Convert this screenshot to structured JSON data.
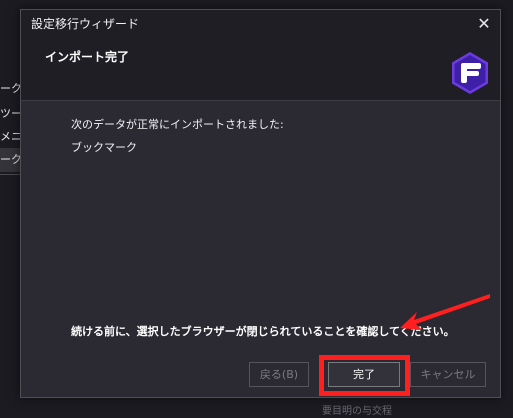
{
  "background": {
    "sidebar_items": [
      "ーク",
      "ツール",
      "メニュ",
      "ーク"
    ],
    "bottom_text": "要目明の与交程"
  },
  "dialog": {
    "title": "設定移行ウィザード",
    "heading": "インポート完了",
    "message": "次のデータが正常にインポートされました:",
    "items": [
      "ブックマーク"
    ],
    "note": "続ける前に、選択したブラウザーが閉じられていることを確認してください。",
    "buttons": {
      "back": "戻る(B)",
      "finish": "完了",
      "cancel": "キャンセル"
    },
    "close_icon": "close-icon"
  },
  "logo": {
    "name": "floorp-logo",
    "colors": {
      "outer": "#6b3be0",
      "inner": "#ffffff"
    }
  },
  "annotation": {
    "highlight_color": "#ff1f1f"
  }
}
